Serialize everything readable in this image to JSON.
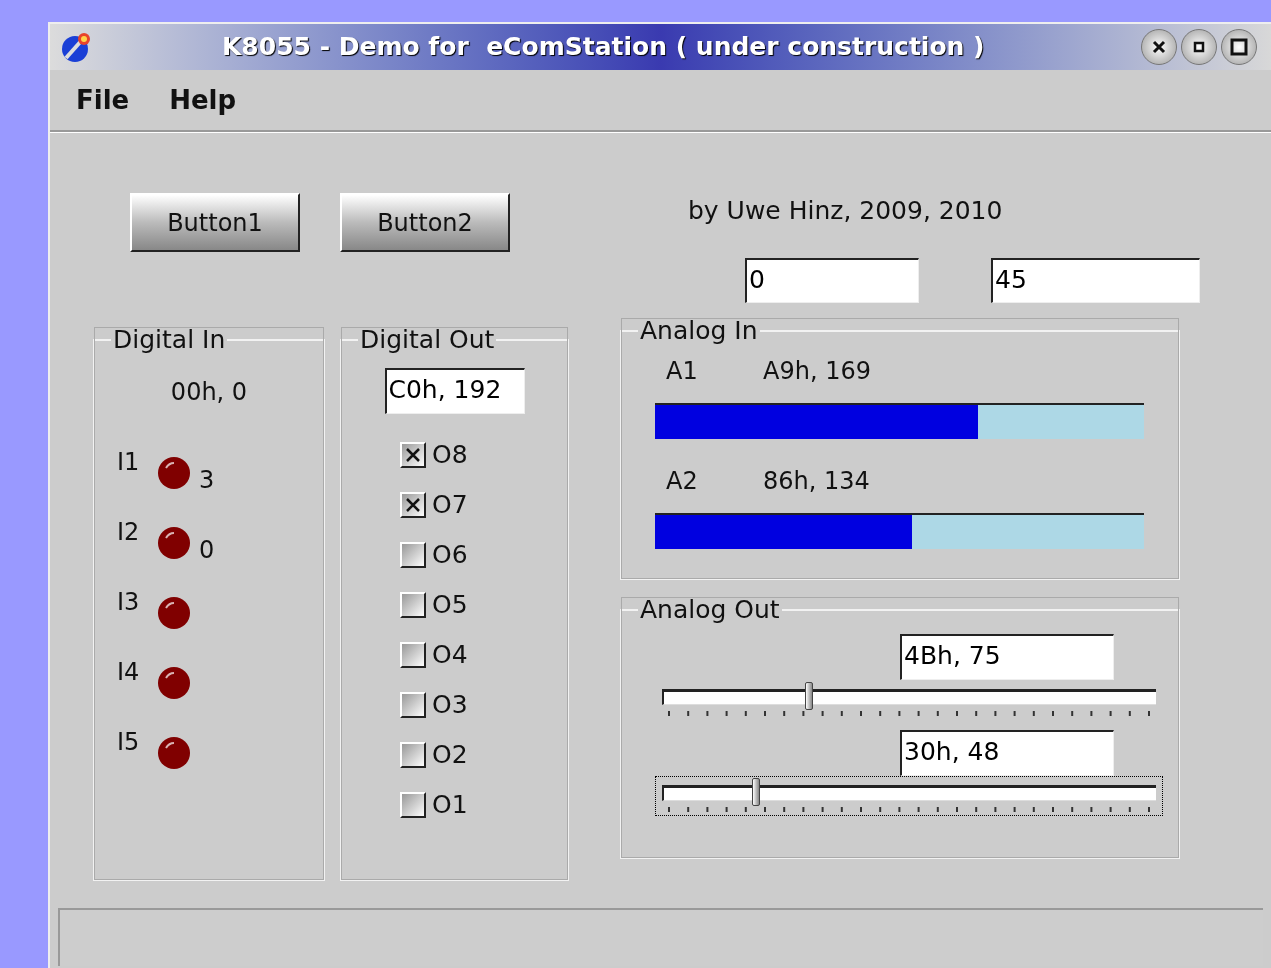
{
  "window": {
    "title": "K8055 - Demo for  eComStation ( under construction )"
  },
  "menu": [
    "File",
    "Help"
  ],
  "buttons": [
    "Button1",
    "Button2"
  ],
  "credit": "by Uwe Hinz, 2009, 2010",
  "fields": [
    {
      "value": "0"
    },
    {
      "value": "45"
    }
  ],
  "digital_in": {
    "title": "Digital In",
    "value": "00h, 0",
    "inputs": [
      {
        "label": "I1",
        "count": "3"
      },
      {
        "label": "I2",
        "count": "0"
      },
      {
        "label": "I3"
      },
      {
        "label": "I4"
      },
      {
        "label": "I5"
      }
    ]
  },
  "digital_out": {
    "title": "Digital Out",
    "value": "C0h, 192",
    "outputs": [
      {
        "label": "O8",
        "checked": true
      },
      {
        "label": "O7",
        "checked": true
      },
      {
        "label": "O6",
        "checked": false
      },
      {
        "label": "O5",
        "checked": false
      },
      {
        "label": "O4",
        "checked": false
      },
      {
        "label": "O3",
        "checked": false
      },
      {
        "label": "O2",
        "checked": false
      },
      {
        "label": "O1",
        "checked": false
      }
    ]
  },
  "analog_in": {
    "title": "Analog In",
    "channels": [
      {
        "label": "A1",
        "reading": "A9h, 169",
        "level": 0.66
      },
      {
        "label": "A2",
        "reading": "86h, 134",
        "level": 0.525
      }
    ]
  },
  "analog_out": {
    "title": "Analog Out",
    "channels": [
      {
        "value": "4Bh, 75",
        "level": 0.294,
        "focused": false
      },
      {
        "value": "30h, 48",
        "level": 0.188,
        "focused": true
      }
    ]
  }
}
